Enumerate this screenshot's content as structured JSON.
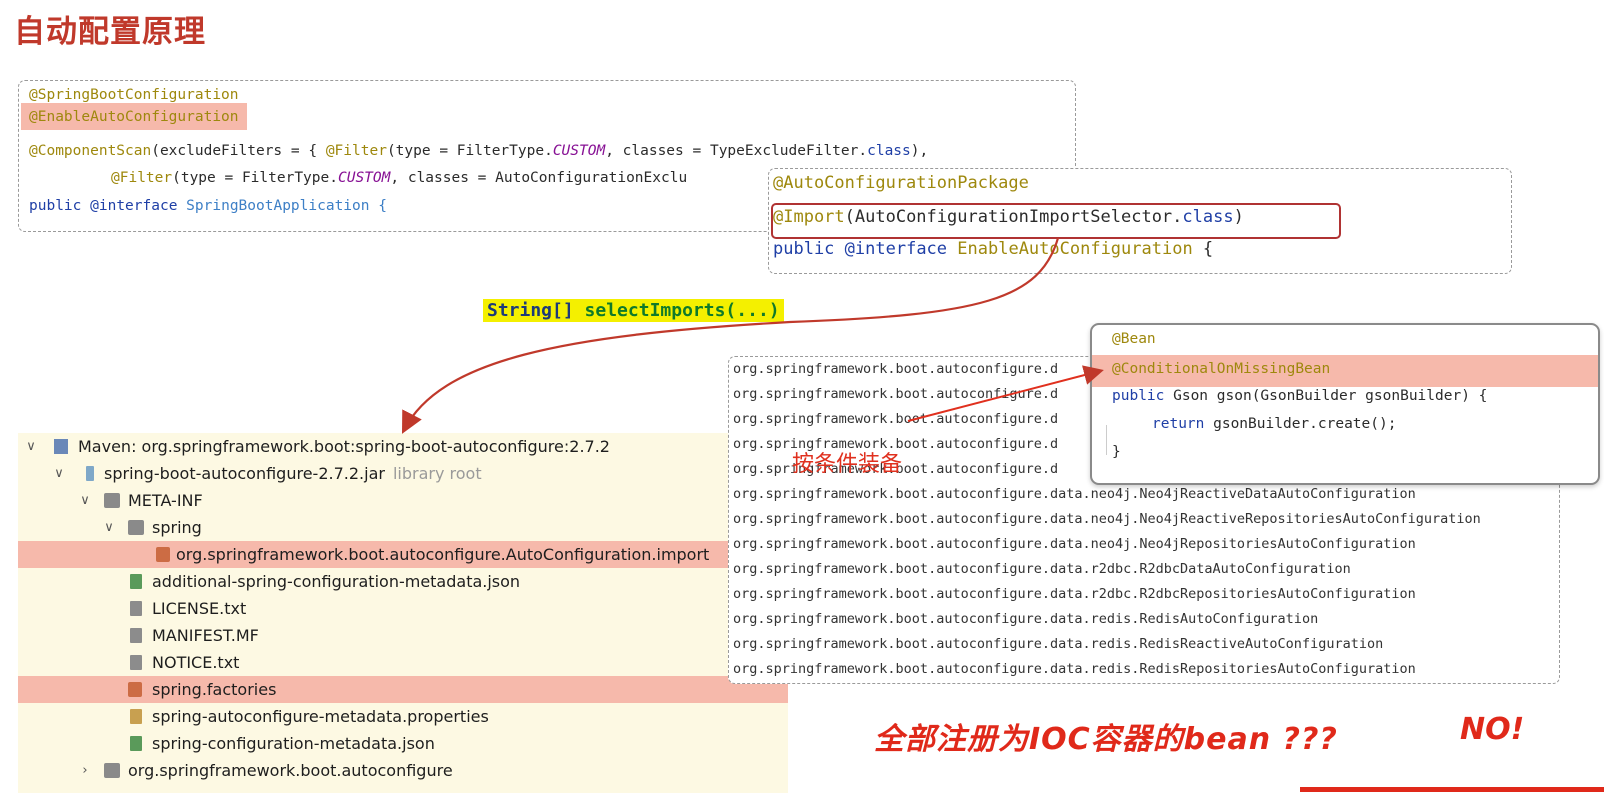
{
  "title": "自动配置原理",
  "code1": {
    "line1": "@SpringBootConfiguration",
    "line2": "@EnableAutoConfiguration",
    "line3_ann": "@ComponentScan",
    "line3_a": "(excludeFilters = { ",
    "line3_filter": "@Filter",
    "line3_b": "(type = FilterType.",
    "line3_const": "CUSTOM",
    "line3_c": ", classes = TypeExcludeFilter.",
    "line3_kw": "class",
    "line3_d": "),",
    "line4_filter": "@Filter",
    "line4_a": "(type = FilterType.",
    "line4_const": "CUSTOM",
    "line4_b": ", classes = AutoConfigurationExclu",
    "line5_kw1": "public",
    "line5_kw2": "@interface",
    "line5_name": "SpringBootApplication {"
  },
  "code2": {
    "line1": "@AutoConfigurationPackage",
    "line2_ann": "@Import",
    "line2_a": "(AutoConfigurationImportSelector.",
    "line2_kw": "class",
    "line2_b": ")",
    "line3_kw1": "public",
    "line3_kw2": "@interface",
    "line3_name": "EnableAutoConfiguration",
    "line3_b": " {"
  },
  "method_label": {
    "type": "String[] ",
    "fn": "selectImports(...)"
  },
  "tree": {
    "maven": "Maven: org.springframework.boot:spring-boot-autoconfigure:2.7.2",
    "jar": "spring-boot-autoconfigure-2.7.2.jar",
    "jar_note": "library root",
    "meta_inf": "META-INF",
    "spring": "spring",
    "imports_file": "org.springframework.boot.autoconfigure.AutoConfiguration.import",
    "metadata_json": "additional-spring-configuration-metadata.json",
    "license": "LICENSE.txt",
    "manifest": "MANIFEST.MF",
    "notice": "NOTICE.txt",
    "factories": "spring.factories",
    "metadata_props": "spring-autoconfigure-metadata.properties",
    "config_json": "spring-configuration-metadata.json",
    "package": "org.springframework.boot.autoconfigure"
  },
  "list": [
    "org.springframework.boot.autoconfigure.d",
    "org.springframework.boot.autoconfigure.d",
    "org.springframework.boot.autoconfigure.d",
    "org.springframework.boot.autoconfigure.d",
    "org.springframework.boot.autoconfigure.d",
    "org.springframework.boot.autoconfigure.data.neo4j.Neo4jReactiveDataAutoConfiguration",
    "org.springframework.boot.autoconfigure.data.neo4j.Neo4jReactiveRepositoriesAutoConfiguration",
    "org.springframework.boot.autoconfigure.data.neo4j.Neo4jRepositoriesAutoConfiguration",
    "org.springframework.boot.autoconfigure.data.r2dbc.R2dbcDataAutoConfiguration",
    "org.springframework.boot.autoconfigure.data.r2dbc.R2dbcRepositoriesAutoConfiguration",
    "org.springframework.boot.autoconfigure.data.redis.RedisAutoConfiguration",
    "org.springframework.boot.autoconfigure.data.redis.RedisReactiveAutoConfiguration",
    "org.springframework.boot.autoconfigure.data.redis.RedisRepositoriesAutoConfiguration"
  ],
  "popup": {
    "line1": "@Bean",
    "line2": "@ConditionalOnMissingBean",
    "line3_kw": "public",
    "line3_rest": " Gson gson(GsonBuilder gsonBuilder) {",
    "line4_kw": "return",
    "line4_rest": " gsonBuilder.create();",
    "line5": "}"
  },
  "note_conditional": "按条件装备",
  "note_bottom": "全部注册为IOC容器的bean ???",
  "note_no": "NO!",
  "colors": {
    "highlight": "#f6b9ab",
    "annotation": "#9e880d",
    "keyword": "#1f3fa6",
    "accent_red": "#e0291a"
  }
}
